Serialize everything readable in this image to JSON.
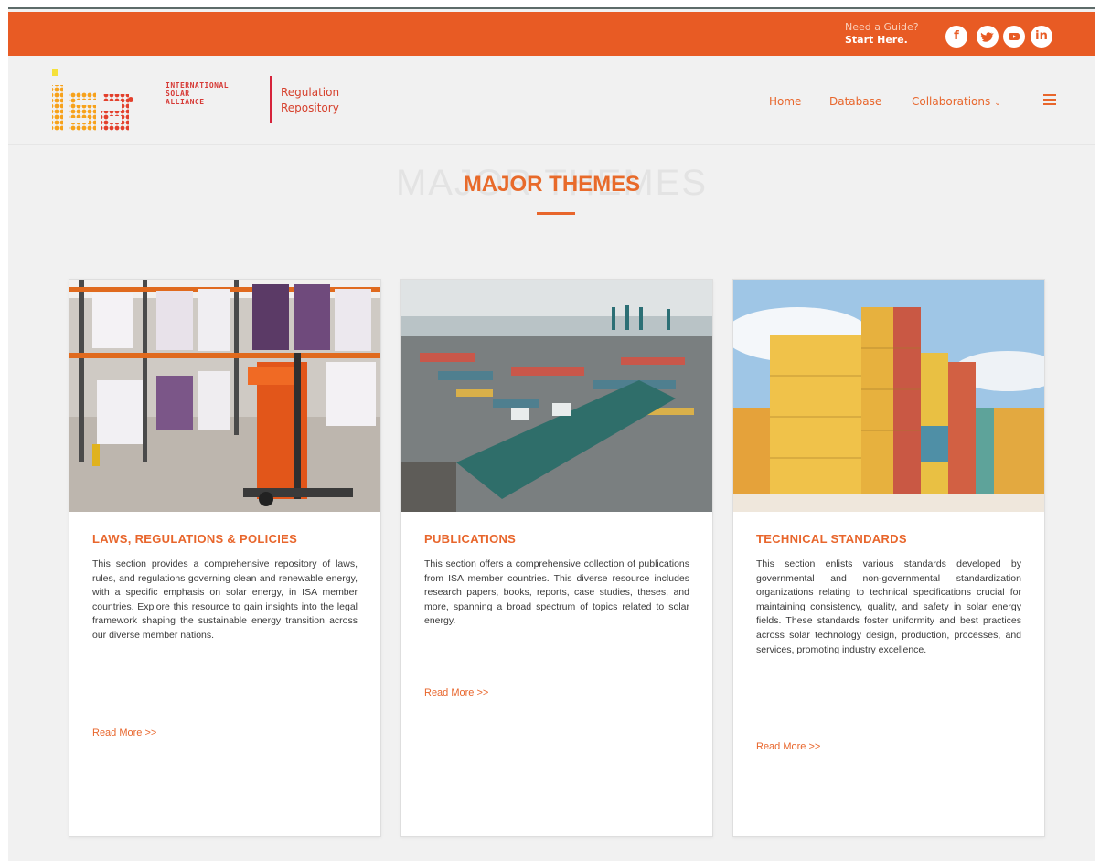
{
  "topbar": {
    "guide_line1": "Need a Guide?",
    "guide_line2": "Start Here.",
    "social": [
      {
        "icon": "facebook-icon",
        "glyph": "f"
      },
      {
        "icon": "twitter-icon",
        "glyph": "🐦"
      },
      {
        "icon": "youtube-icon",
        "glyph": "▶"
      },
      {
        "icon": "linkedin-icon",
        "glyph": "in"
      }
    ],
    "color": "#e85b24"
  },
  "header": {
    "logo_text": "isa",
    "logo_words": [
      "INTERNATIONAL",
      "SOLAR",
      "ALLIANCE"
    ],
    "repo_line1": "Regulation",
    "repo_line2": "Repository",
    "nav": {
      "home": "Home",
      "database": "Database",
      "collaborations": "Collaborations"
    }
  },
  "section": {
    "ghost_title": "MAJOR THEMES",
    "title": "MAJOR THEMES"
  },
  "cards": [
    {
      "title": "LAWS, REGULATIONS & POLICIES",
      "description": "This section provides a comprehensive repository of laws, rules, and regulations governing clean and renewable energy, with a specific emphasis on solar energy, in ISA member countries. Explore this resource to gain insights into the legal framework shaping the sustainable energy transition across our diverse member nations.",
      "read_more": "Read More >>",
      "image": "warehouse-forklift"
    },
    {
      "title": "PUBLICATIONS",
      "description": "This section offers a comprehensive collection of publications from ISA member countries. This diverse resource includes research papers, books, reports, case studies, theses, and more, spanning a broad spectrum of topics related to solar energy.",
      "read_more": "Read More >>",
      "image": "container-port"
    },
    {
      "title": "TECHNICAL STANDARDS",
      "description": "This section enlists various standards developed by governmental and non-governmental standardization organizations relating to technical specifications crucial for maintaining consistency, quality, and safety in solar energy fields. These standards foster uniformity and best practices across solar technology design, production, processes, and services, promoting industry excellence.",
      "read_more": "Read More >>",
      "image": "stacked-containers"
    }
  ],
  "colors": {
    "accent": "#e8662c",
    "background": "#f1f1f1"
  }
}
